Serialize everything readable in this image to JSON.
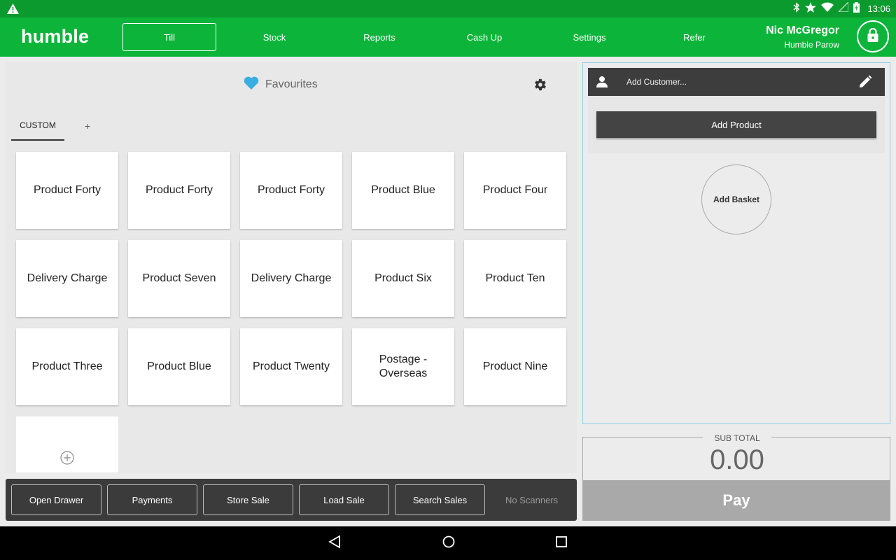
{
  "status_bar": {
    "time": "13:06",
    "icons": [
      "warning-icon",
      "bluetooth-icon",
      "star-icon",
      "wifi-icon",
      "signal-icon",
      "battery-icon"
    ]
  },
  "header": {
    "logo": "humble",
    "nav": [
      {
        "label": "Till",
        "active": true
      },
      {
        "label": "Stock",
        "active": false
      },
      {
        "label": "Reports",
        "active": false
      },
      {
        "label": "Cash Up",
        "active": false
      },
      {
        "label": "Settings",
        "active": false
      },
      {
        "label": "Refer",
        "active": false
      }
    ],
    "user_name": "Nic McGregor",
    "store_name": "Humble Parow"
  },
  "favourites": {
    "title": "Favourites",
    "tabs": [
      {
        "label": "CUSTOM",
        "active": true
      },
      {
        "label": "+",
        "active": false
      }
    ],
    "products": [
      "Product Forty",
      "Product Forty",
      "Product Forty",
      "Product Blue",
      "Product Four",
      "Delivery Charge",
      "Product Seven",
      "Delivery Charge",
      "Product Six",
      "Product Ten",
      "Product Three",
      "Product Blue",
      "Product Twenty",
      "Postage - Overseas",
      "Product Nine"
    ]
  },
  "toolbar": {
    "buttons": [
      "Open Drawer",
      "Payments",
      "Store Sale",
      "Load Sale",
      "Search Sales"
    ],
    "scanner_status": "No Scanners"
  },
  "sale": {
    "customer_placeholder": "Add Customer...",
    "add_product_label": "Add Product",
    "add_basket_label": "Add Basket",
    "subtotal_label": "SUB TOTAL",
    "subtotal_value": "0.00",
    "pay_label": "Pay"
  },
  "colors": {
    "brand_green": "#0db43a",
    "status_green": "#0a9a2e",
    "heart_blue": "#3aaee0",
    "pay_disabled": "#a9a9a9"
  }
}
